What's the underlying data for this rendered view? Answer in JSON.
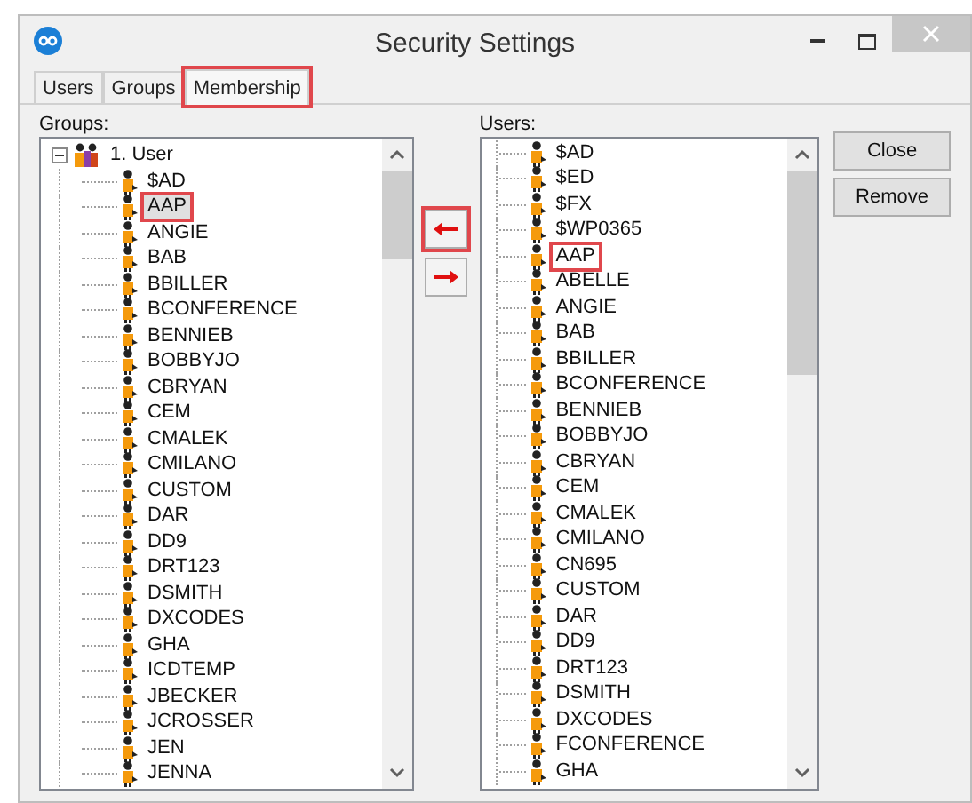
{
  "window": {
    "title": "Security Settings"
  },
  "tabs": [
    {
      "label": "Users",
      "selected": false,
      "marked": false
    },
    {
      "label": "Groups",
      "selected": false,
      "marked": false
    },
    {
      "label": "Membership",
      "selected": true,
      "marked": true
    }
  ],
  "groups": {
    "label": "Groups:",
    "root": {
      "label": "1. User",
      "expanded": true,
      "children": [
        {
          "label": "$AD",
          "selected": false,
          "marked": false
        },
        {
          "label": "AAP",
          "selected": true,
          "marked": true
        },
        {
          "label": "ANGIE",
          "selected": false,
          "marked": false
        },
        {
          "label": "BAB",
          "selected": false,
          "marked": false
        },
        {
          "label": "BBILLER",
          "selected": false,
          "marked": false
        },
        {
          "label": "BCONFERENCE",
          "selected": false,
          "marked": false
        },
        {
          "label": "BENNIEB",
          "selected": false,
          "marked": false
        },
        {
          "label": "BOBBYJO",
          "selected": false,
          "marked": false
        },
        {
          "label": "CBRYAN",
          "selected": false,
          "marked": false
        },
        {
          "label": "CEM",
          "selected": false,
          "marked": false
        },
        {
          "label": "CMALEK",
          "selected": false,
          "marked": false
        },
        {
          "label": "CMILANO",
          "selected": false,
          "marked": false
        },
        {
          "label": "CUSTOM",
          "selected": false,
          "marked": false
        },
        {
          "label": "DAR",
          "selected": false,
          "marked": false
        },
        {
          "label": "DD9",
          "selected": false,
          "marked": false
        },
        {
          "label": "DRT123",
          "selected": false,
          "marked": false
        },
        {
          "label": "DSMITH",
          "selected": false,
          "marked": false
        },
        {
          "label": "DXCODES",
          "selected": false,
          "marked": false
        },
        {
          "label": "GHA",
          "selected": false,
          "marked": false
        },
        {
          "label": "ICDTEMP",
          "selected": false,
          "marked": false
        },
        {
          "label": "JBECKER",
          "selected": false,
          "marked": false
        },
        {
          "label": "JCROSSER",
          "selected": false,
          "marked": false
        },
        {
          "label": "JEN",
          "selected": false,
          "marked": false
        },
        {
          "label": "JENNA",
          "selected": false,
          "marked": false
        }
      ]
    }
  },
  "move_buttons": [
    {
      "kind": "left",
      "marked": true
    },
    {
      "kind": "right",
      "marked": false
    }
  ],
  "users": {
    "label": "Users:",
    "items": [
      {
        "label": "$AD",
        "marked": false
      },
      {
        "label": "$ED",
        "marked": false
      },
      {
        "label": "$FX",
        "marked": false
      },
      {
        "label": "$WP0365",
        "marked": false
      },
      {
        "label": "AAP",
        "marked": true
      },
      {
        "label": "ABELLE",
        "marked": false
      },
      {
        "label": "ANGIE",
        "marked": false
      },
      {
        "label": "BAB",
        "marked": false
      },
      {
        "label": "BBILLER",
        "marked": false
      },
      {
        "label": "BCONFERENCE",
        "marked": false
      },
      {
        "label": "BENNIEB",
        "marked": false
      },
      {
        "label": "BOBBYJO",
        "marked": false
      },
      {
        "label": "CBRYAN",
        "marked": false
      },
      {
        "label": "CEM",
        "marked": false
      },
      {
        "label": "CMALEK",
        "marked": false
      },
      {
        "label": "CMILANO",
        "marked": false
      },
      {
        "label": "CN695",
        "marked": false
      },
      {
        "label": "CUSTOM",
        "marked": false
      },
      {
        "label": "DAR",
        "marked": false
      },
      {
        "label": "DD9",
        "marked": false
      },
      {
        "label": "DRT123",
        "marked": false
      },
      {
        "label": "DSMITH",
        "marked": false
      },
      {
        "label": "DXCODES",
        "marked": false
      },
      {
        "label": "FCONFERENCE",
        "marked": false
      },
      {
        "label": "GHA",
        "marked": false
      }
    ]
  },
  "buttons": [
    "Close",
    "Remove"
  ]
}
